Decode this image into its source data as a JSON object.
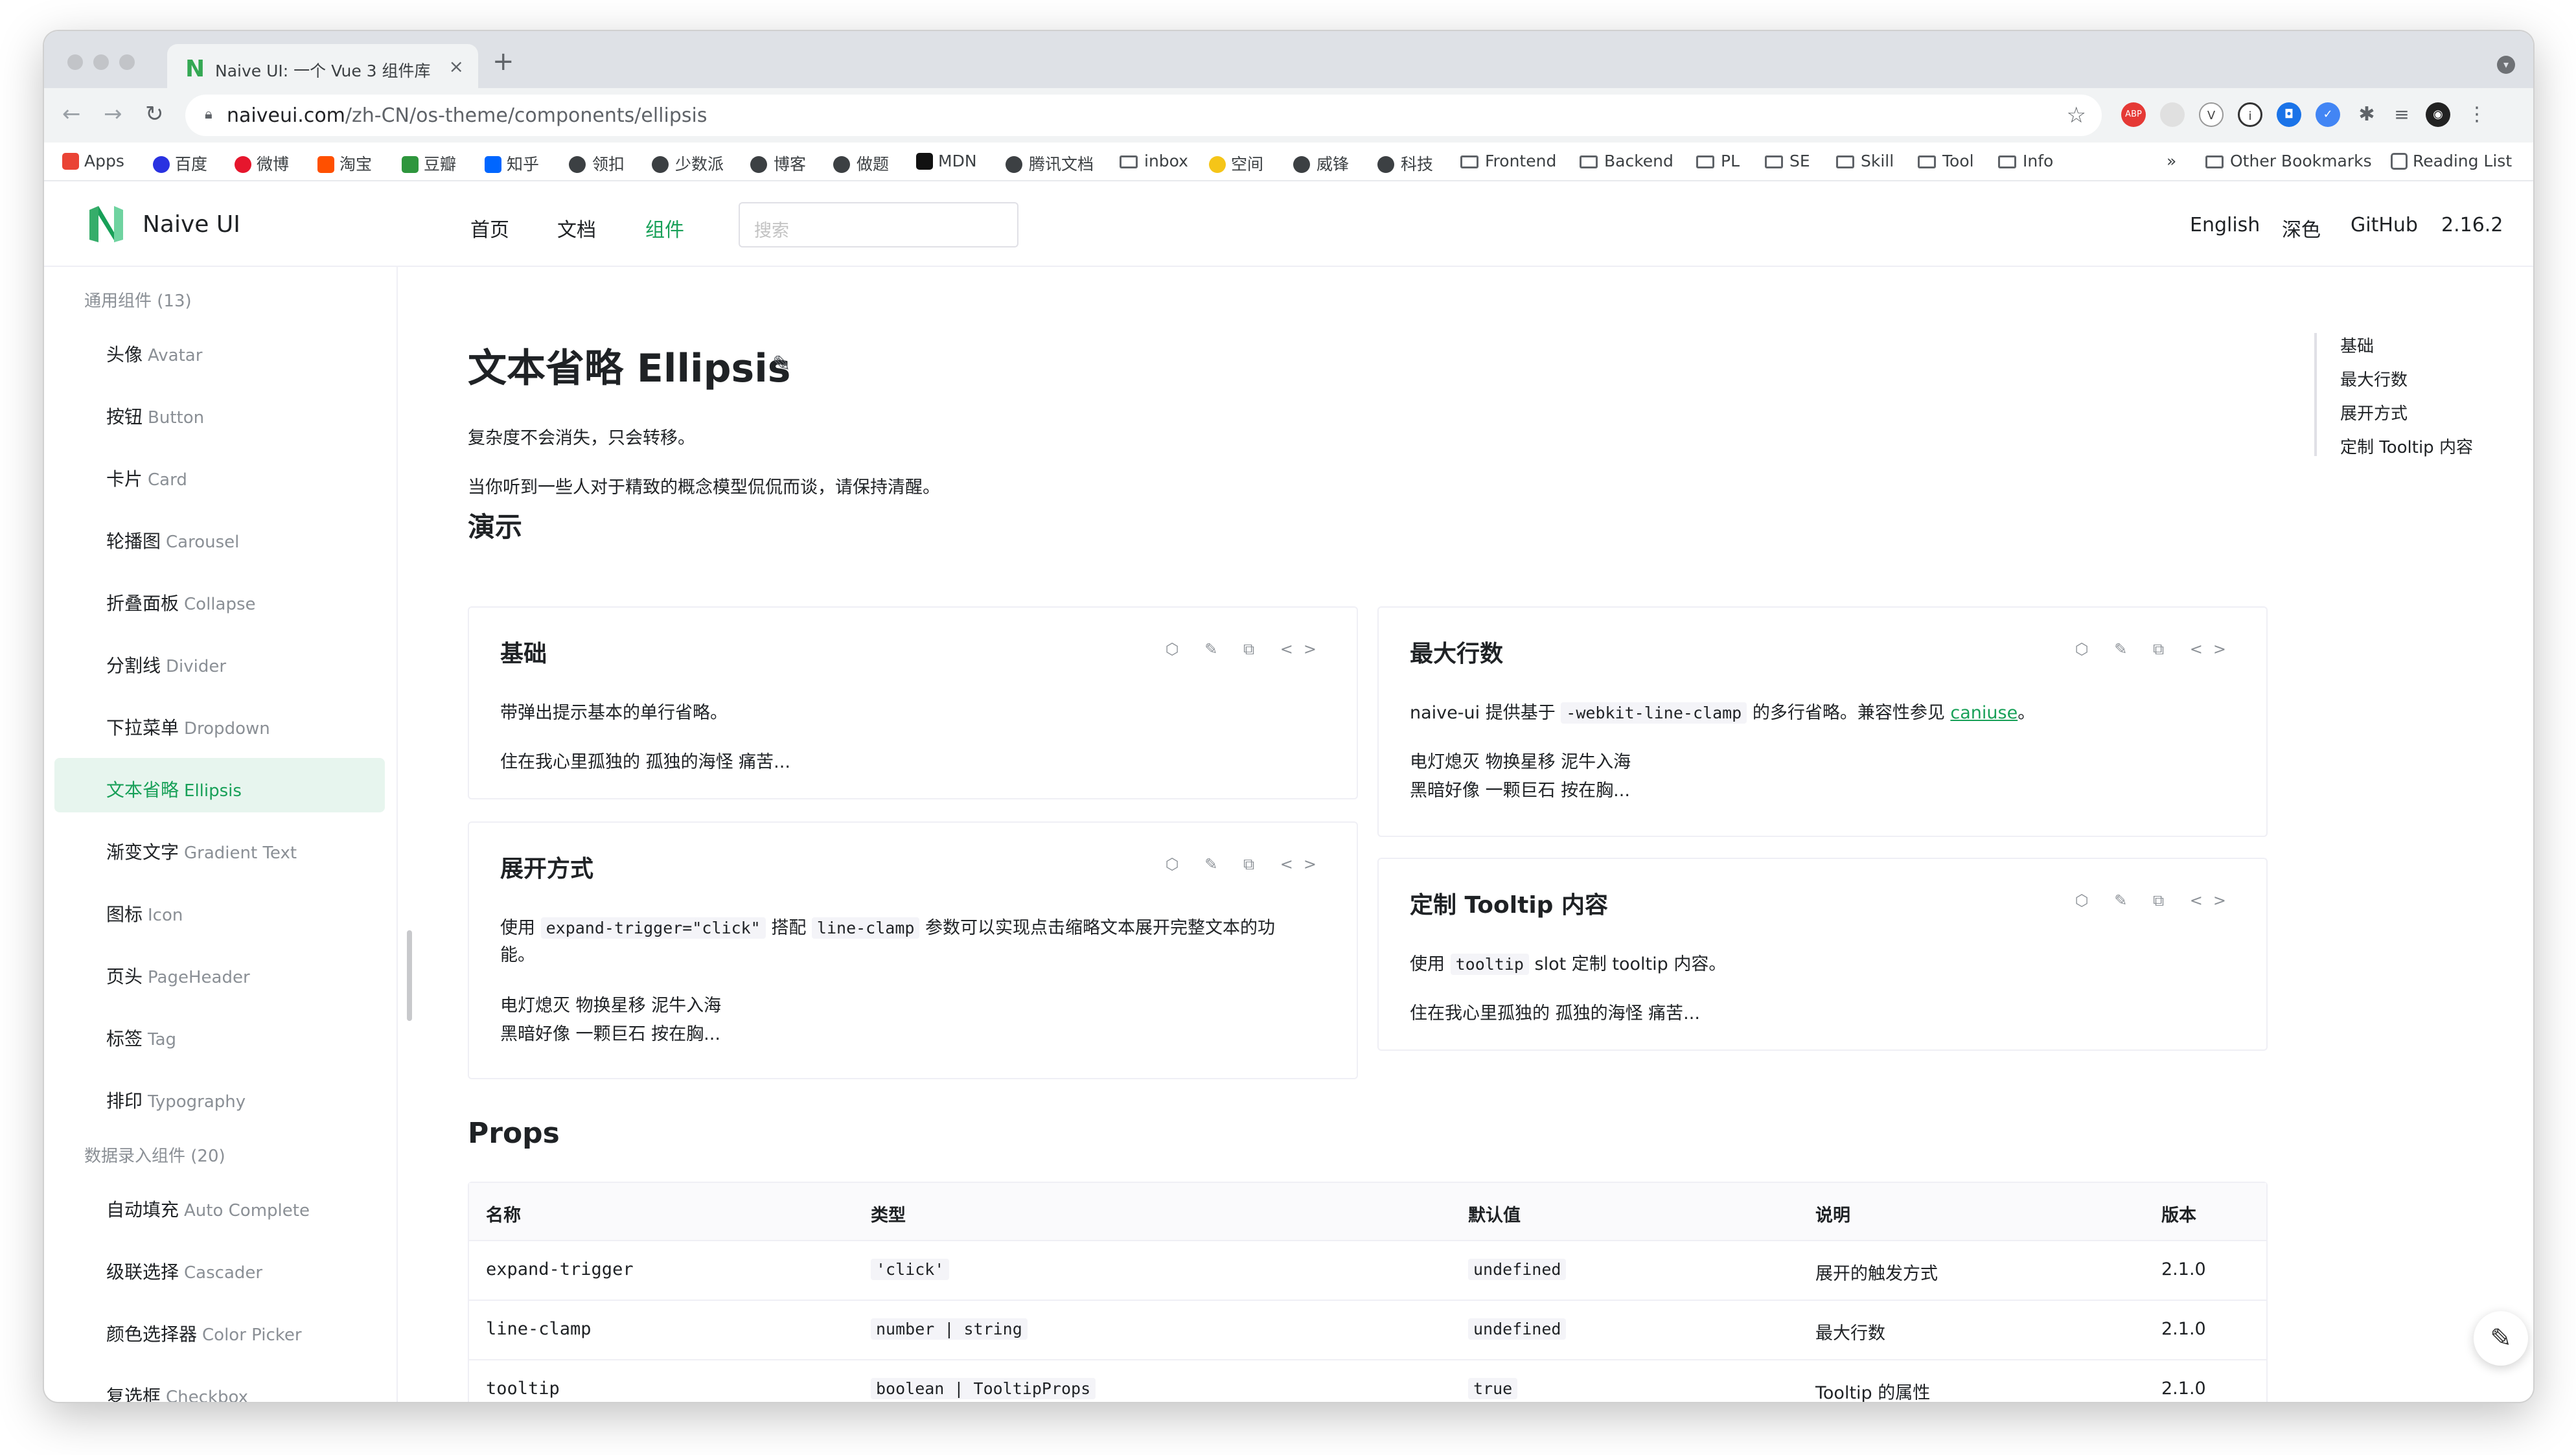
{
  "browser": {
    "tab_title": "Naive UI: 一个 Vue 3 组件库",
    "tab_logo": "N",
    "tab_close": "×",
    "new_tab": "+",
    "url_host": "naiveui.com",
    "url_path": "/zh-CN/os-theme/components/ellipsis",
    "bookmarks": [
      "Apps",
      "百度",
      "微博",
      "淘宝",
      "豆瓣",
      "知乎",
      "领扣",
      "少数派",
      "博客",
      "做题",
      "MDN",
      "腾讯文档",
      "inbox",
      "空间",
      "威锋",
      "科技",
      "Frontend",
      "Backend",
      "PL",
      "SE",
      "Skill",
      "Tool",
      "Info"
    ],
    "bookmarks_more": "»",
    "other_bookmarks": "Other Bookmarks",
    "reading_list": "Reading List"
  },
  "header": {
    "brand": "Naive UI",
    "nav": [
      "首页",
      "文档",
      "组件"
    ],
    "search_placeholder": "搜索",
    "right": [
      "English",
      "深色",
      "GitHub",
      "2.16.2"
    ]
  },
  "sidebar": {
    "group1": "通用组件 (13)",
    "items": [
      {
        "zh": "头像",
        "en": "Avatar"
      },
      {
        "zh": "按钮",
        "en": "Button"
      },
      {
        "zh": "卡片",
        "en": "Card"
      },
      {
        "zh": "轮播图",
        "en": "Carousel"
      },
      {
        "zh": "折叠面板",
        "en": "Collapse"
      },
      {
        "zh": "分割线",
        "en": "Divider"
      },
      {
        "zh": "下拉菜单",
        "en": "Dropdown"
      },
      {
        "zh": "文本省略",
        "en": "Ellipsis"
      },
      {
        "zh": "渐变文字",
        "en": "Gradient Text"
      },
      {
        "zh": "图标",
        "en": "Icon"
      },
      {
        "zh": "页头",
        "en": "PageHeader"
      },
      {
        "zh": "标签",
        "en": "Tag"
      },
      {
        "zh": "排印",
        "en": "Typography"
      }
    ],
    "group2": "数据录入组件 (20)",
    "items2": [
      {
        "zh": "自动填充",
        "en": "Auto Complete"
      },
      {
        "zh": "级联选择",
        "en": "Cascader"
      },
      {
        "zh": "颜色选择器",
        "en": "Color Picker"
      },
      {
        "zh": "复选框",
        "en": "Checkbox"
      }
    ]
  },
  "main": {
    "title": "文本省略 Ellipsis",
    "intro1": "复杂度不会消失，只会转移。",
    "intro2": "当你听到一些人对于精致的概念模型侃侃而谈，请保持清醒。",
    "demo_heading": "演示",
    "card_icons": "⬡ ✎ ⧉ <>",
    "cards": {
      "basic": {
        "title": "基础",
        "desc": "带弹出提示基本的单行省略。",
        "sample": "住在我心里孤独的 孤独的海怪 痛苦..."
      },
      "expand": {
        "title": "展开方式",
        "desc_a": "使用",
        "code1": "expand-trigger=\"click\"",
        "desc_b": "搭配",
        "code2": "line-clamp",
        "desc_c": "参数可以实现点击缩略文本展开完整文本的功",
        "desc_d": "能。",
        "line1": "电灯熄灭 物换星移 泥牛入海",
        "line2": "黑暗好像 一颗巨石 按在胸..."
      },
      "lineclamp": {
        "title": "最大行数",
        "desc_a": "naive-ui 提供基于",
        "code": "-webkit-line-clamp",
        "desc_b": "的多行省略。兼容性参见",
        "link": "caniuse",
        "desc_c": "。",
        "line1": "电灯熄灭 物换星移 泥牛入海",
        "line2": "黑暗好像 一颗巨石 按在胸..."
      },
      "tooltip": {
        "title": "定制 Tooltip 内容",
        "desc_a": "使用",
        "code": "tooltip",
        "desc_b": "slot 定制 tooltip 内容。",
        "sample": "住在我心里孤独的 孤独的海怪 痛苦..."
      }
    },
    "props_heading": "Props",
    "table_headers": [
      "名称",
      "类型",
      "默认值",
      "说明",
      "版本"
    ],
    "table_rows": [
      {
        "name": "expand-trigger",
        "type": "'click'",
        "default": "undefined",
        "desc": "展开的触发方式",
        "version": "2.1.0"
      },
      {
        "name": "line-clamp",
        "type": "number | string",
        "default": "undefined",
        "desc": "最大行数",
        "version": "2.1.0"
      },
      {
        "name": "tooltip",
        "type": "boolean | TooltipProps",
        "default": "true",
        "desc": "Tooltip 的属性",
        "version": "2.1.0"
      }
    ]
  },
  "anchor": [
    "基础",
    "最大行数",
    "展开方式",
    "定制 Tooltip 内容"
  ],
  "colors": {
    "accent": "#18a058",
    "active_bg": "#e7f5ee"
  }
}
